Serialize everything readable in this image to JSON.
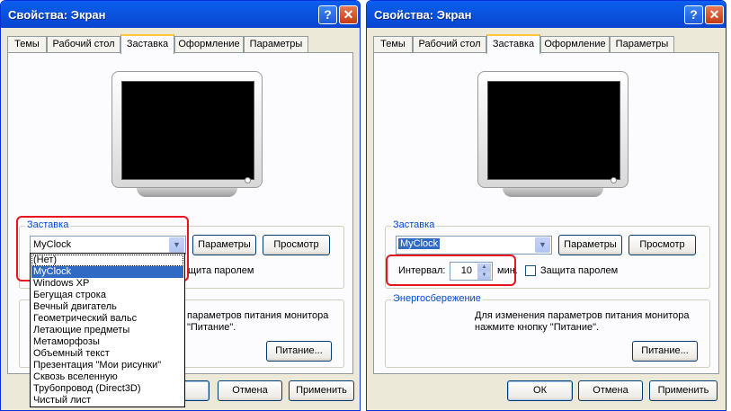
{
  "window_title": "Свойства: Экран",
  "help_glyph": "?",
  "close_glyph": "✕",
  "tabs": [
    "Темы",
    "Рабочий стол",
    "Заставка",
    "Оформление",
    "Параметры"
  ],
  "left": {
    "screensaver_group": "Заставка",
    "screensaver_value": "MyClock",
    "settings_button": "Параметры",
    "preview_button": "Просмотр",
    "password_partial": "щита паролем",
    "power_text_line1": "параметров питания монитора",
    "power_text_line2": "\"Питание\".",
    "power_button": "Питание...",
    "cancel_button": "Отмена",
    "apply_button": "Применить",
    "dropdown_options": [
      "(Нет)",
      "MyClock",
      "Windows XP",
      "Бегущая строка",
      "Вечный двигатель",
      "Геометрический вальс",
      "Летающие предметы",
      "Метаморфозы",
      "Объемный текст",
      "Презентация \"Мои рисунки\"",
      "Сквозь вселенную",
      "Трубопровод (Direct3D)",
      "Чистый лист"
    ],
    "dropdown_selected_index": 1
  },
  "right": {
    "screensaver_group": "Заставка",
    "screensaver_value": "MyClock",
    "settings_button": "Параметры",
    "preview_button": "Просмотр",
    "interval_label": "Интервал:",
    "interval_value": "10",
    "interval_unit": "мин.",
    "password_label": "Защита паролем",
    "energy_group": "Энергосбережение",
    "power_text_line1": "Для изменения параметров питания монитора",
    "power_text_line2": "нажмите кнопку \"Питание\".",
    "power_button": "Питание...",
    "ok_button": "ОК",
    "cancel_button": "Отмена",
    "apply_button": "Применить"
  },
  "colors": {
    "titlebar": "#0a55e0",
    "highlight_box": "#e8141f",
    "selection": "#316ac5",
    "group_label": "#0046d5"
  }
}
